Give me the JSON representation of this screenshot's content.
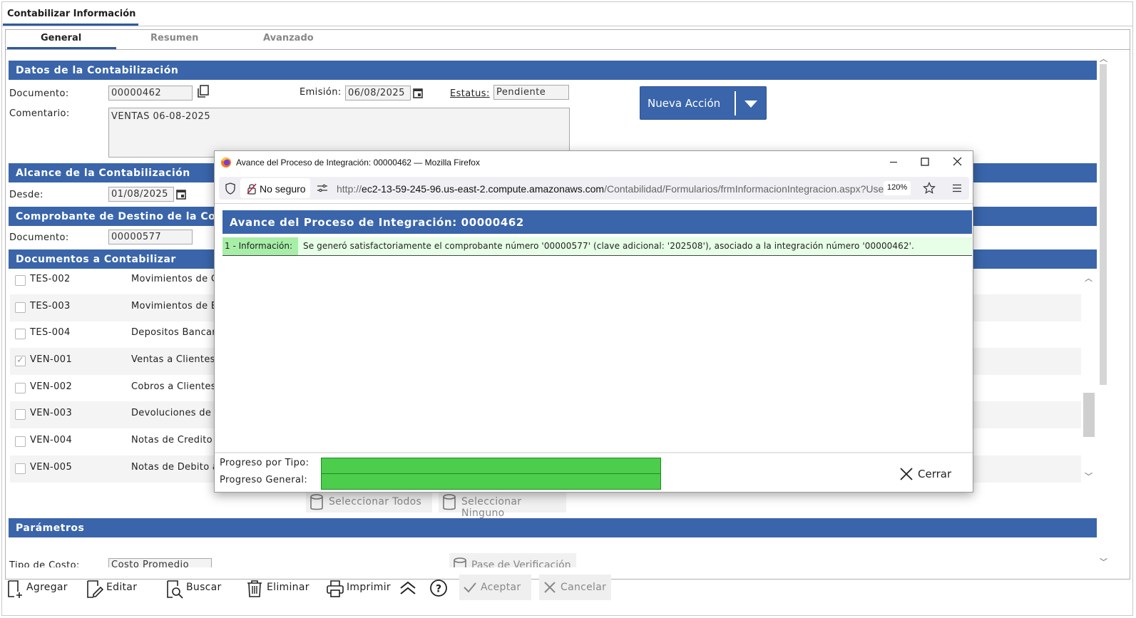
{
  "app": {
    "title": "Contabilizar Información"
  },
  "tabs": [
    {
      "label": "General",
      "active": true
    },
    {
      "label": "Resumen",
      "active": false
    },
    {
      "label": "Avanzado",
      "active": false
    }
  ],
  "datos": {
    "section_title": "Datos de la Contabilización",
    "documento_label": "Documento:",
    "documento_value": "00000462",
    "emision_label": "Emisión:",
    "emision_value": "06/08/2025",
    "estatus_label": "Estatus:",
    "estatus_value": "Pendiente",
    "comentario_label": "Comentario:",
    "comentario_value": "VENTAS 06-08-2025",
    "nueva_accion_label": "Nueva Acción"
  },
  "alcance": {
    "section_title": "Alcance de la Contabilización",
    "desde_label": "Desde:",
    "desde_value": "01/08/2025"
  },
  "comprobante": {
    "section_title": "Comprobante de Destino de la Co",
    "documento_label": "Documento:",
    "documento_value": "00000577"
  },
  "documentos": {
    "section_title": "Documentos a Contabilizar",
    "rows": [
      {
        "code": "TES-002",
        "desc": "Movimientos de Ca",
        "checked": false
      },
      {
        "code": "TES-003",
        "desc": "Movimientos de Ba",
        "checked": false
      },
      {
        "code": "TES-004",
        "desc": "Depositos Bancario",
        "checked": false
      },
      {
        "code": "VEN-001",
        "desc": "Ventas a Clientes",
        "checked": true
      },
      {
        "code": "VEN-002",
        "desc": "Cobros a Clientes",
        "checked": false
      },
      {
        "code": "VEN-003",
        "desc": "Devoluciones de C",
        "checked": false
      },
      {
        "code": "VEN-004",
        "desc": "Notas de Credito a",
        "checked": false
      },
      {
        "code": "VEN-005",
        "desc": "Notas de Debito a",
        "checked": false
      }
    ],
    "select_all_label": "Seleccionar Todos",
    "select_none_label": "Seleccionar Ninguno"
  },
  "parametros": {
    "section_title": "Parámetros",
    "tipo_costo_label": "Tipo de Costo:",
    "tipo_costo_value": "Costo Promedio",
    "pase_label": "Pase de Verificación"
  },
  "toolbar": {
    "agregar": "Agregar",
    "editar": "Editar",
    "buscar": "Buscar",
    "eliminar": "Eliminar",
    "imprimir": "Imprimir",
    "aceptar": "Aceptar",
    "cancelar": "Cancelar"
  },
  "popup": {
    "window_title": "Avance del Proceso de Integración: 00000462 — Mozilla Firefox",
    "not_secure": "No seguro",
    "url_prefix": "http://",
    "url_host": "ec2-13-59-245-96.us-east-2.compute.amazonaws.com",
    "url_path": "/Contabilidad/Formularios/frmInformacionIntegracion.aspx?UserID",
    "zoom": "120%",
    "header": "Avance del Proceso de Integración: 00000462",
    "info_tag": "1 - Información:",
    "info_message": "Se generó satisfactoriamente el comprobante número '00000577' (clave adicional: '202508'), asociado a la integración número '00000462'.",
    "progreso_tipo_label": "Progreso por Tipo:",
    "progreso_tipo_value": 1.0,
    "progreso_general_label": "Progreso General:",
    "progreso_general_value": 1.0,
    "cerrar_label": "Cerrar"
  },
  "colors": {
    "section_blue": "#3a65aa",
    "progress_green": "#4ccd4c",
    "info_green": "#e6ffe6"
  }
}
